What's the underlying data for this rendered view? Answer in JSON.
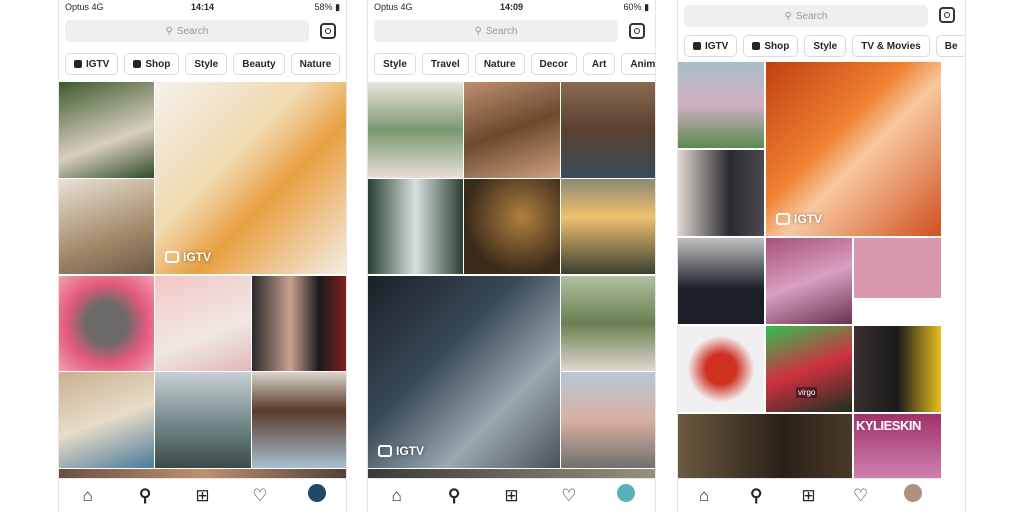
{
  "screens": [
    {
      "carrier": "Optus",
      "network": "4G",
      "time": "14:14",
      "battery": "58%",
      "search_placeholder": "Search",
      "chips": [
        "IGTV",
        "Shop",
        "Style",
        "Beauty",
        "Nature"
      ],
      "igtv_label": "IGTV"
    },
    {
      "carrier": "Optus",
      "network": "4G",
      "time": "14:09",
      "battery": "60%",
      "search_placeholder": "Search",
      "chips": [
        "Style",
        "Travel",
        "Nature",
        "Decor",
        "Art",
        "Anim"
      ],
      "igtv_label": "IGTV"
    },
    {
      "search_placeholder": "Search",
      "chips": [
        "IGTV",
        "Shop",
        "Style",
        "TV & Movies",
        "Be"
      ],
      "igtv_label": "IGTV",
      "overlay_text": "KYLIESKIN",
      "sticker_text": "virgo"
    }
  ],
  "nav_icons": [
    "home-icon",
    "search-icon",
    "add-post-icon",
    "heart-icon",
    "profile-avatar"
  ],
  "colors": {
    "accent_dot": "#ed4956",
    "chip_border": "#dbdbdb",
    "search_bg": "#efefef"
  }
}
